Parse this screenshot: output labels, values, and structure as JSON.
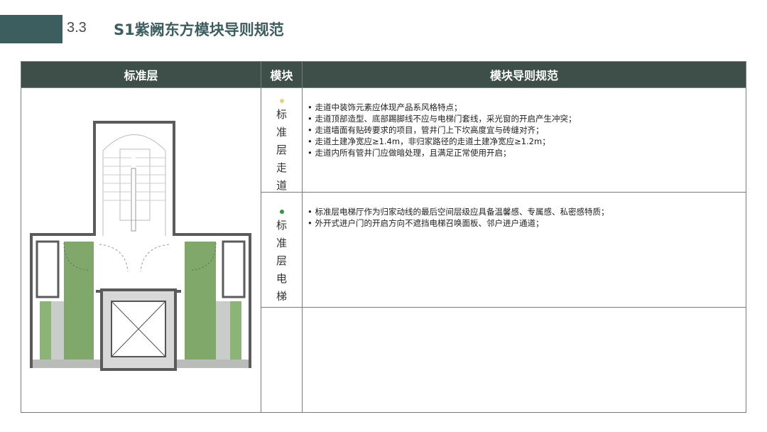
{
  "header": {
    "section_number": "3.3",
    "title": "S1紫阙东方模块导则规范"
  },
  "table": {
    "columns": [
      "标准层",
      "模块",
      "模块导则规范"
    ],
    "rows": [
      {
        "module": [
          "标",
          "准",
          "层",
          "走",
          "道"
        ],
        "dot_color": "#e8d27a",
        "rules": [
          "走道中装饰元素应体现产品系风格特点；",
          "走道顶部造型、底部踢脚线不应与电梯门套线，采光窗的开启产生冲突；",
          "走道墙面有贴砖要求的项目，管井门上下坎高度宜与砖缝对齐；",
          "走道土建净宽应≥1.4m，非归家路径的走道土建净宽应≥1.2m；",
          "走道内所有管井门应做暗处理，且满足正常使用开启；"
        ]
      },
      {
        "module": [
          "标",
          "准",
          "层",
          "电",
          "梯"
        ],
        "dot_color": "#2f9a3a",
        "rules": [
          "标准层电梯厅作为归家动线的最后空间层级应具备温馨感、专属感、私密感特质；",
          "外开式进户门的开启方向不遮挡电梯召唤面板、邻户进户通道；"
        ]
      }
    ]
  },
  "plan_colors": {
    "wall": "#5b5b5b",
    "green": "#7fa86a",
    "stone": "#b9bcb8"
  }
}
